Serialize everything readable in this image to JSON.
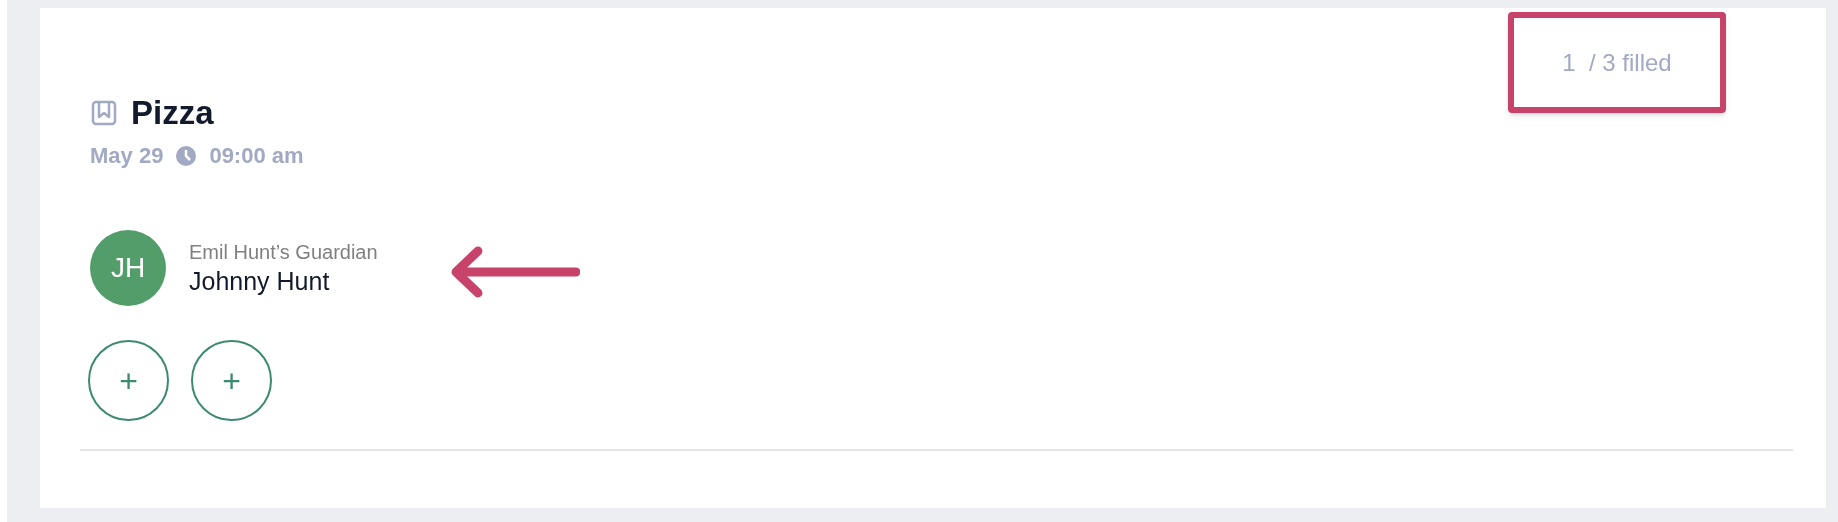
{
  "event": {
    "title": "Pizza",
    "date": "May 29",
    "time": "09:00 am",
    "fill_count": "1  / 3 filled"
  },
  "slots": [
    {
      "kind": "person",
      "initials": "JH",
      "color": "#539d6a",
      "relation": "Emil Hunt’s Guardian",
      "name": "Johnny Hunt"
    },
    {
      "kind": "empty",
      "symbol": "+"
    },
    {
      "kind": "empty",
      "symbol": "+"
    }
  ]
}
